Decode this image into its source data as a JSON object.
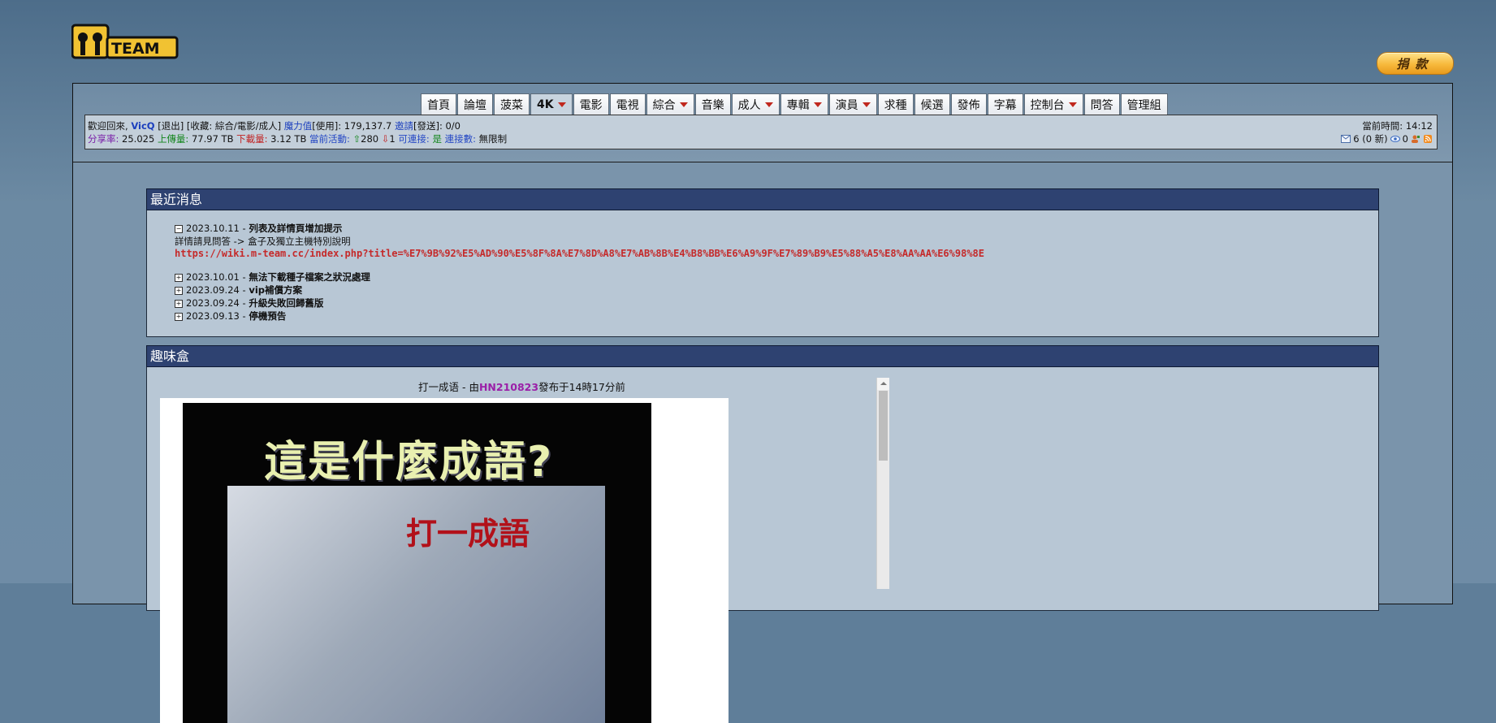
{
  "logo": {
    "icon": "mteam-logo",
    "alt": "M-Team"
  },
  "donate": {
    "label": "捐款"
  },
  "nav": [
    {
      "label": "首頁",
      "dropdown": false,
      "active": false
    },
    {
      "label": "論壇",
      "dropdown": false,
      "active": false
    },
    {
      "label": "菠菜",
      "dropdown": false,
      "active": false
    },
    {
      "label": "4K",
      "dropdown": true,
      "active": true
    },
    {
      "label": "電影",
      "dropdown": false,
      "active": false
    },
    {
      "label": "電視",
      "dropdown": false,
      "active": false
    },
    {
      "label": "綜合",
      "dropdown": true,
      "active": false
    },
    {
      "label": "音樂",
      "dropdown": false,
      "active": false
    },
    {
      "label": "成人",
      "dropdown": true,
      "active": false
    },
    {
      "label": "專輯",
      "dropdown": true,
      "active": false
    },
    {
      "label": "演員",
      "dropdown": true,
      "active": false
    },
    {
      "label": "求種",
      "dropdown": false,
      "active": false
    },
    {
      "label": "候選",
      "dropdown": false,
      "active": false
    },
    {
      "label": "發佈",
      "dropdown": false,
      "active": false
    },
    {
      "label": "字幕",
      "dropdown": false,
      "active": false
    },
    {
      "label": "控制台",
      "dropdown": true,
      "active": false
    },
    {
      "label": "問答",
      "dropdown": false,
      "active": false
    },
    {
      "label": "管理組",
      "dropdown": false,
      "active": false
    }
  ],
  "userbar": {
    "welcome": "歡迎回來,",
    "username": "VicQ",
    "logout": "[退出]",
    "bookmarks": "[收藏:",
    "bookmark_cats": "綜合/電影/成人]",
    "magic_label": "魔力值",
    "magic_value": "[使用]: 179,137.7",
    "invite_label": "邀請",
    "invite_value": "[發送]: 0/0",
    "ratio_label": "分享率:",
    "ratio_value": "25.025",
    "upload_label": "上傳量:",
    "upload_value": "77.97 TB",
    "download_label": "下載量:",
    "download_value": "3.12 TB",
    "active_label": "當前活動:",
    "active_seed": "280",
    "active_leech": "1",
    "connectable_label": "可連接:",
    "connectable_value": "是",
    "connections_label": "連接數:",
    "connections_value": "無限制",
    "time_label": "當前時間:",
    "time_value": "14:12",
    "messages": "6 (0 新)",
    "friends": "0",
    "icons": [
      "mail-icon",
      "eye-icon",
      "user-icon",
      "rss-icon"
    ]
  },
  "news": {
    "title": "最近消息",
    "items": [
      {
        "toggle": "−",
        "date": "2023.10.11",
        "sep": " - ",
        "title": "列表及詳情頁增加提示",
        "body": "詳情請見問答 -> 盒子及獨立主機特別說明",
        "link": "https://wiki.m-team.cc/index.php?title=%E7%9B%92%E5%AD%90%E5%8F%8A%E7%8D%A8%E7%AB%8B%E4%B8%BB%E6%A9%9F%E7%89%B9%E5%88%A5%E8%AA%AA%E6%98%8E"
      },
      {
        "toggle": "+",
        "date": "2023.10.01",
        "sep": " - ",
        "title": "無法下載種子檔案之狀況處理"
      },
      {
        "toggle": "+",
        "date": "2023.09.24",
        "sep": " - ",
        "title": "vip補償方案"
      },
      {
        "toggle": "+",
        "date": "2023.09.24",
        "sep": " - ",
        "title": "升級失敗回歸舊版"
      },
      {
        "toggle": "+",
        "date": "2023.09.13",
        "sep": " - ",
        "title": "停機預告"
      }
    ]
  },
  "funbox": {
    "title": "趣味盒",
    "caption_prefix": "打一成语 - 由",
    "author": "HN210823",
    "caption_suffix": "發布于14時17分前",
    "image_text_main": "這是什麼成語?",
    "image_text_sub": "打一成語"
  }
}
